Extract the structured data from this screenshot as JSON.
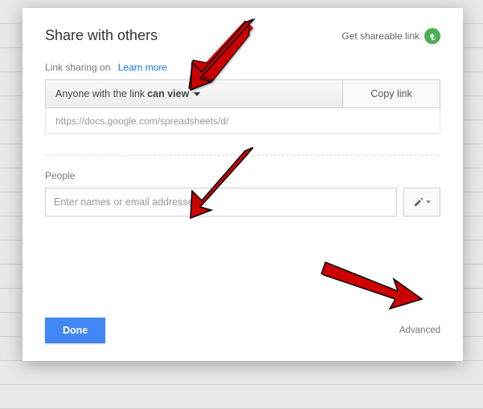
{
  "header": {
    "title": "Share with others",
    "shareable_link": "Get shareable link"
  },
  "link_sharing": {
    "status": "Link sharing on",
    "learn_more": "Learn more",
    "permission_prefix": "Anyone with the link",
    "permission_bold": "can view",
    "copy_link": "Copy link",
    "url": "https://docs.google.com/spreadsheets/d/"
  },
  "people": {
    "label": "People",
    "placeholder": "Enter names or email addresses..."
  },
  "footer": {
    "done": "Done",
    "advanced": "Advanced"
  }
}
